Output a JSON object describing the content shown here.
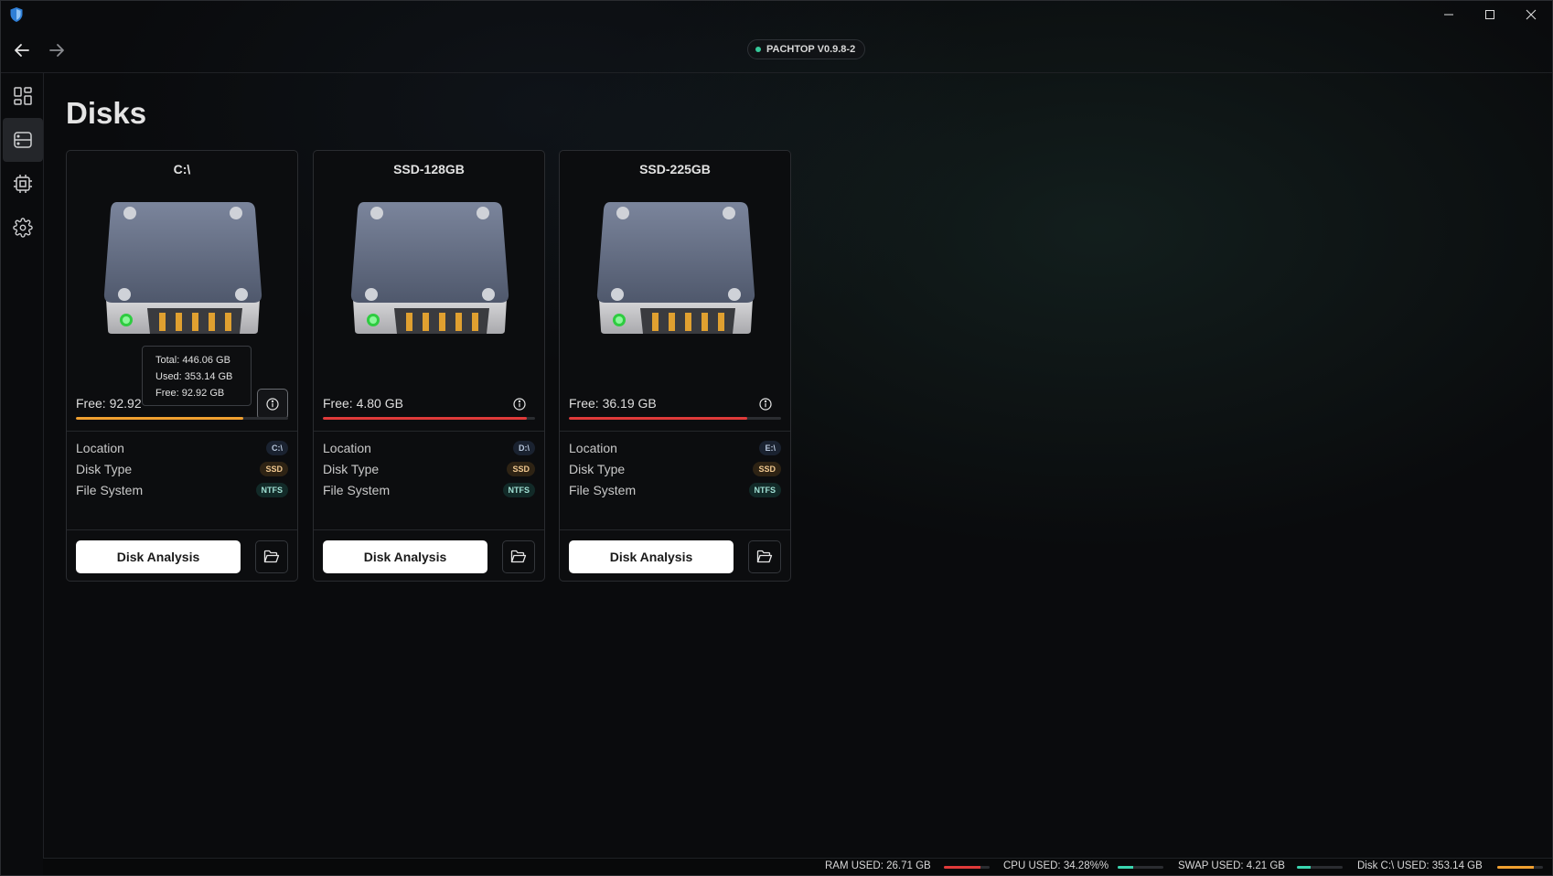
{
  "window": {
    "minimize_icon": "minimize-icon",
    "maximize_icon": "maximize-icon",
    "close_icon": "close-icon"
  },
  "header": {
    "version": "PACHTOP V0.9.8-2",
    "status_color": "#36c99a"
  },
  "sidebar": {
    "items": [
      {
        "icon": "dashboard-icon",
        "active": false
      },
      {
        "icon": "disks-icon",
        "active": true
      },
      {
        "icon": "processor-icon",
        "active": false
      },
      {
        "icon": "settings-icon",
        "active": false
      }
    ]
  },
  "page": {
    "title": "Disks"
  },
  "labels": {
    "location": "Location",
    "disk_type": "Disk Type",
    "file_system": "File System",
    "disk_analysis": "Disk Analysis"
  },
  "disks": [
    {
      "name": "C:\\",
      "free": "Free: 92.92",
      "used_fraction": 0.79,
      "bar_color": "#f0a030",
      "location": "C:\\",
      "type": "SSD",
      "fs": "NTFS"
    },
    {
      "name": "SSD-128GB",
      "free": "Free: 4.80 GB",
      "used_fraction": 0.96,
      "bar_color": "#e03a3a",
      "location": "D:\\",
      "type": "SSD",
      "fs": "NTFS"
    },
    {
      "name": "SSD-225GB",
      "free": "Free: 36.19 GB",
      "used_fraction": 0.84,
      "bar_color": "#e03a3a",
      "location": "E:\\",
      "type": "SSD",
      "fs": "NTFS"
    }
  ],
  "tooltip": {
    "total": "Total: 446.06 GB",
    "used": "Used: 353.14 GB",
    "free": "Free: 92.92 GB"
  },
  "status": {
    "ram": {
      "label": "RAM USED: 26.71 GB",
      "fraction": 0.8,
      "color": "#e03a3a"
    },
    "cpu": {
      "label": "CPU USED: 34.28%%",
      "fraction": 0.34,
      "color": "#3ad6b0"
    },
    "swap": {
      "label": "SWAP USED: 4.21 GB",
      "fraction": 0.3,
      "color": "#3ad6b0"
    },
    "disk": {
      "label": "Disk C:\\ USED: 353.14 GB",
      "fraction": 0.79,
      "color": "#f0a030"
    }
  }
}
